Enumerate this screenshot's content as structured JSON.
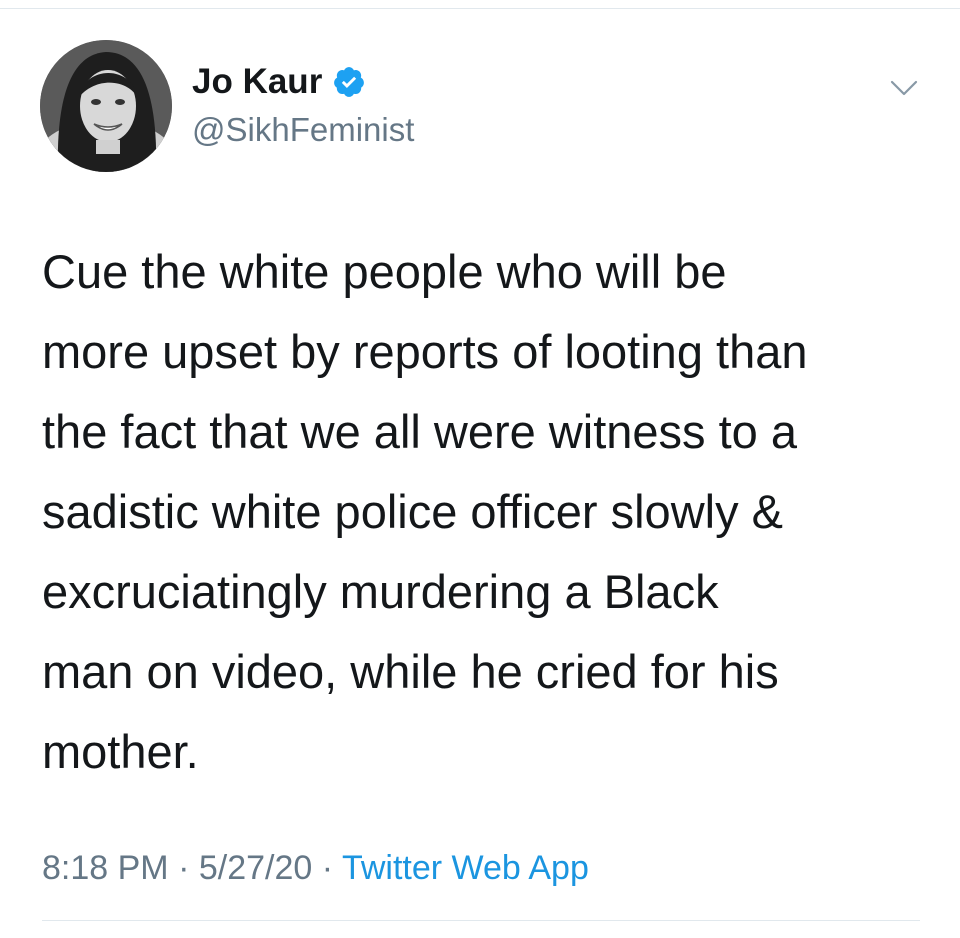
{
  "tweet": {
    "author": {
      "display_name": "Jo Kaur",
      "handle": "@SikhFeminist",
      "verified": true,
      "avatar_icon": "profile-photo"
    },
    "text": "Cue the white people who will be\nmore upset by reports of looting than\nthe fact that we all were witness to a\nsadistic white police officer slowly &\nexcruciatingly murdering a Black\nman on video, while he cried for his\nmother.",
    "time": "8:18 PM",
    "date": "5/27/20",
    "separator": "·",
    "source": "Twitter Web App",
    "menu_icon": "chevron-down-icon"
  },
  "colors": {
    "text_primary": "#14171a",
    "text_secondary": "#657786",
    "link": "#1b95e0",
    "verified": "#1da1f2",
    "divider": "#e1e8ed"
  }
}
